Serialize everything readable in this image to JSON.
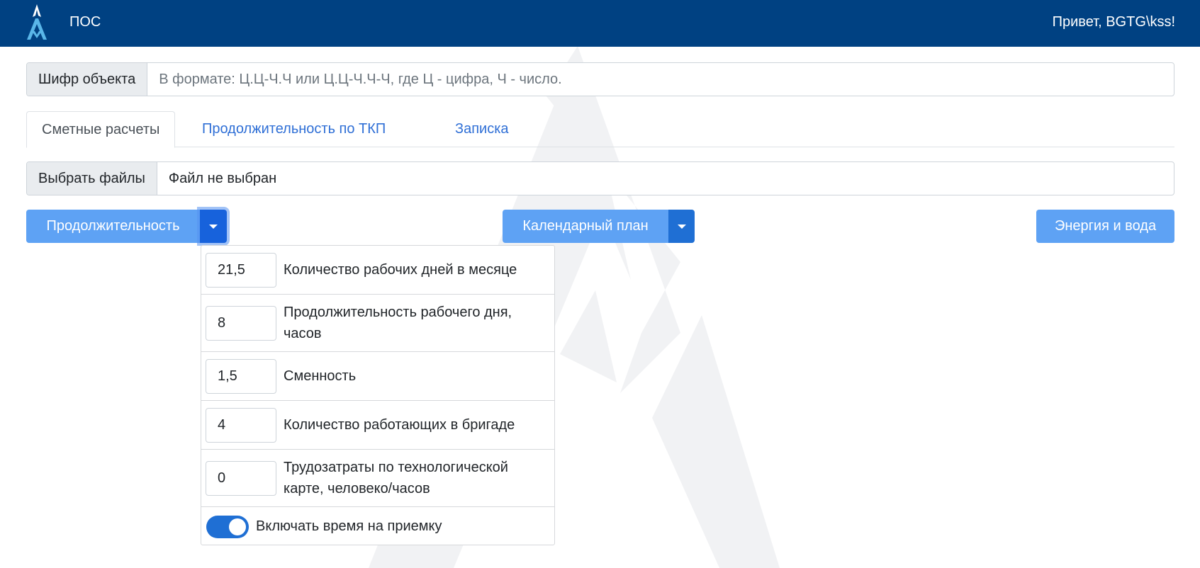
{
  "navbar": {
    "app_name": "ПОС",
    "greeting": "Привет, BGTG\\kss!"
  },
  "object_code": {
    "label": "Шифр объекта",
    "placeholder": "В формате: Ц.Ц-Ч.Ч или Ц.Ц-Ч.Ч-Ч, где Ц - цифра, Ч - число."
  },
  "tabs": [
    {
      "label": "Сметные расчеты",
      "active": true
    },
    {
      "label": "Продолжительность по ТКП",
      "active": false
    },
    {
      "label": "Записка",
      "active": false
    }
  ],
  "file_input": {
    "button_label": "Выбрать файлы",
    "status": "Файл не выбран"
  },
  "actions": {
    "duration_label": "Продолжительность",
    "calendar_label": "Календарный план",
    "energy_label": "Энергия и вода"
  },
  "duration_dropdown": {
    "fields": [
      {
        "value": "21,5",
        "label": "Количество рабочих дней в месяце"
      },
      {
        "value": "8",
        "label_line1": "Продолжительность рабочего дня,",
        "label_line2": "часов"
      },
      {
        "value": "1,5",
        "label": "Сменность"
      },
      {
        "value": "4",
        "label": "Количество работающих в бригаде"
      },
      {
        "value": "0",
        "label_line1": "Трудозатраты по технологической",
        "label_line2": "карте, человеко/часов"
      }
    ],
    "toggle": {
      "label": "Включать время на приемку",
      "checked": true
    }
  },
  "colors": {
    "navbar": "#004182",
    "accent": "#1f6fd4",
    "button_light": "#5ea2f4",
    "link": "#2f6fd6"
  },
  "icons": {
    "brand": "company-logo-icon",
    "caret": "caret-down-icon"
  }
}
